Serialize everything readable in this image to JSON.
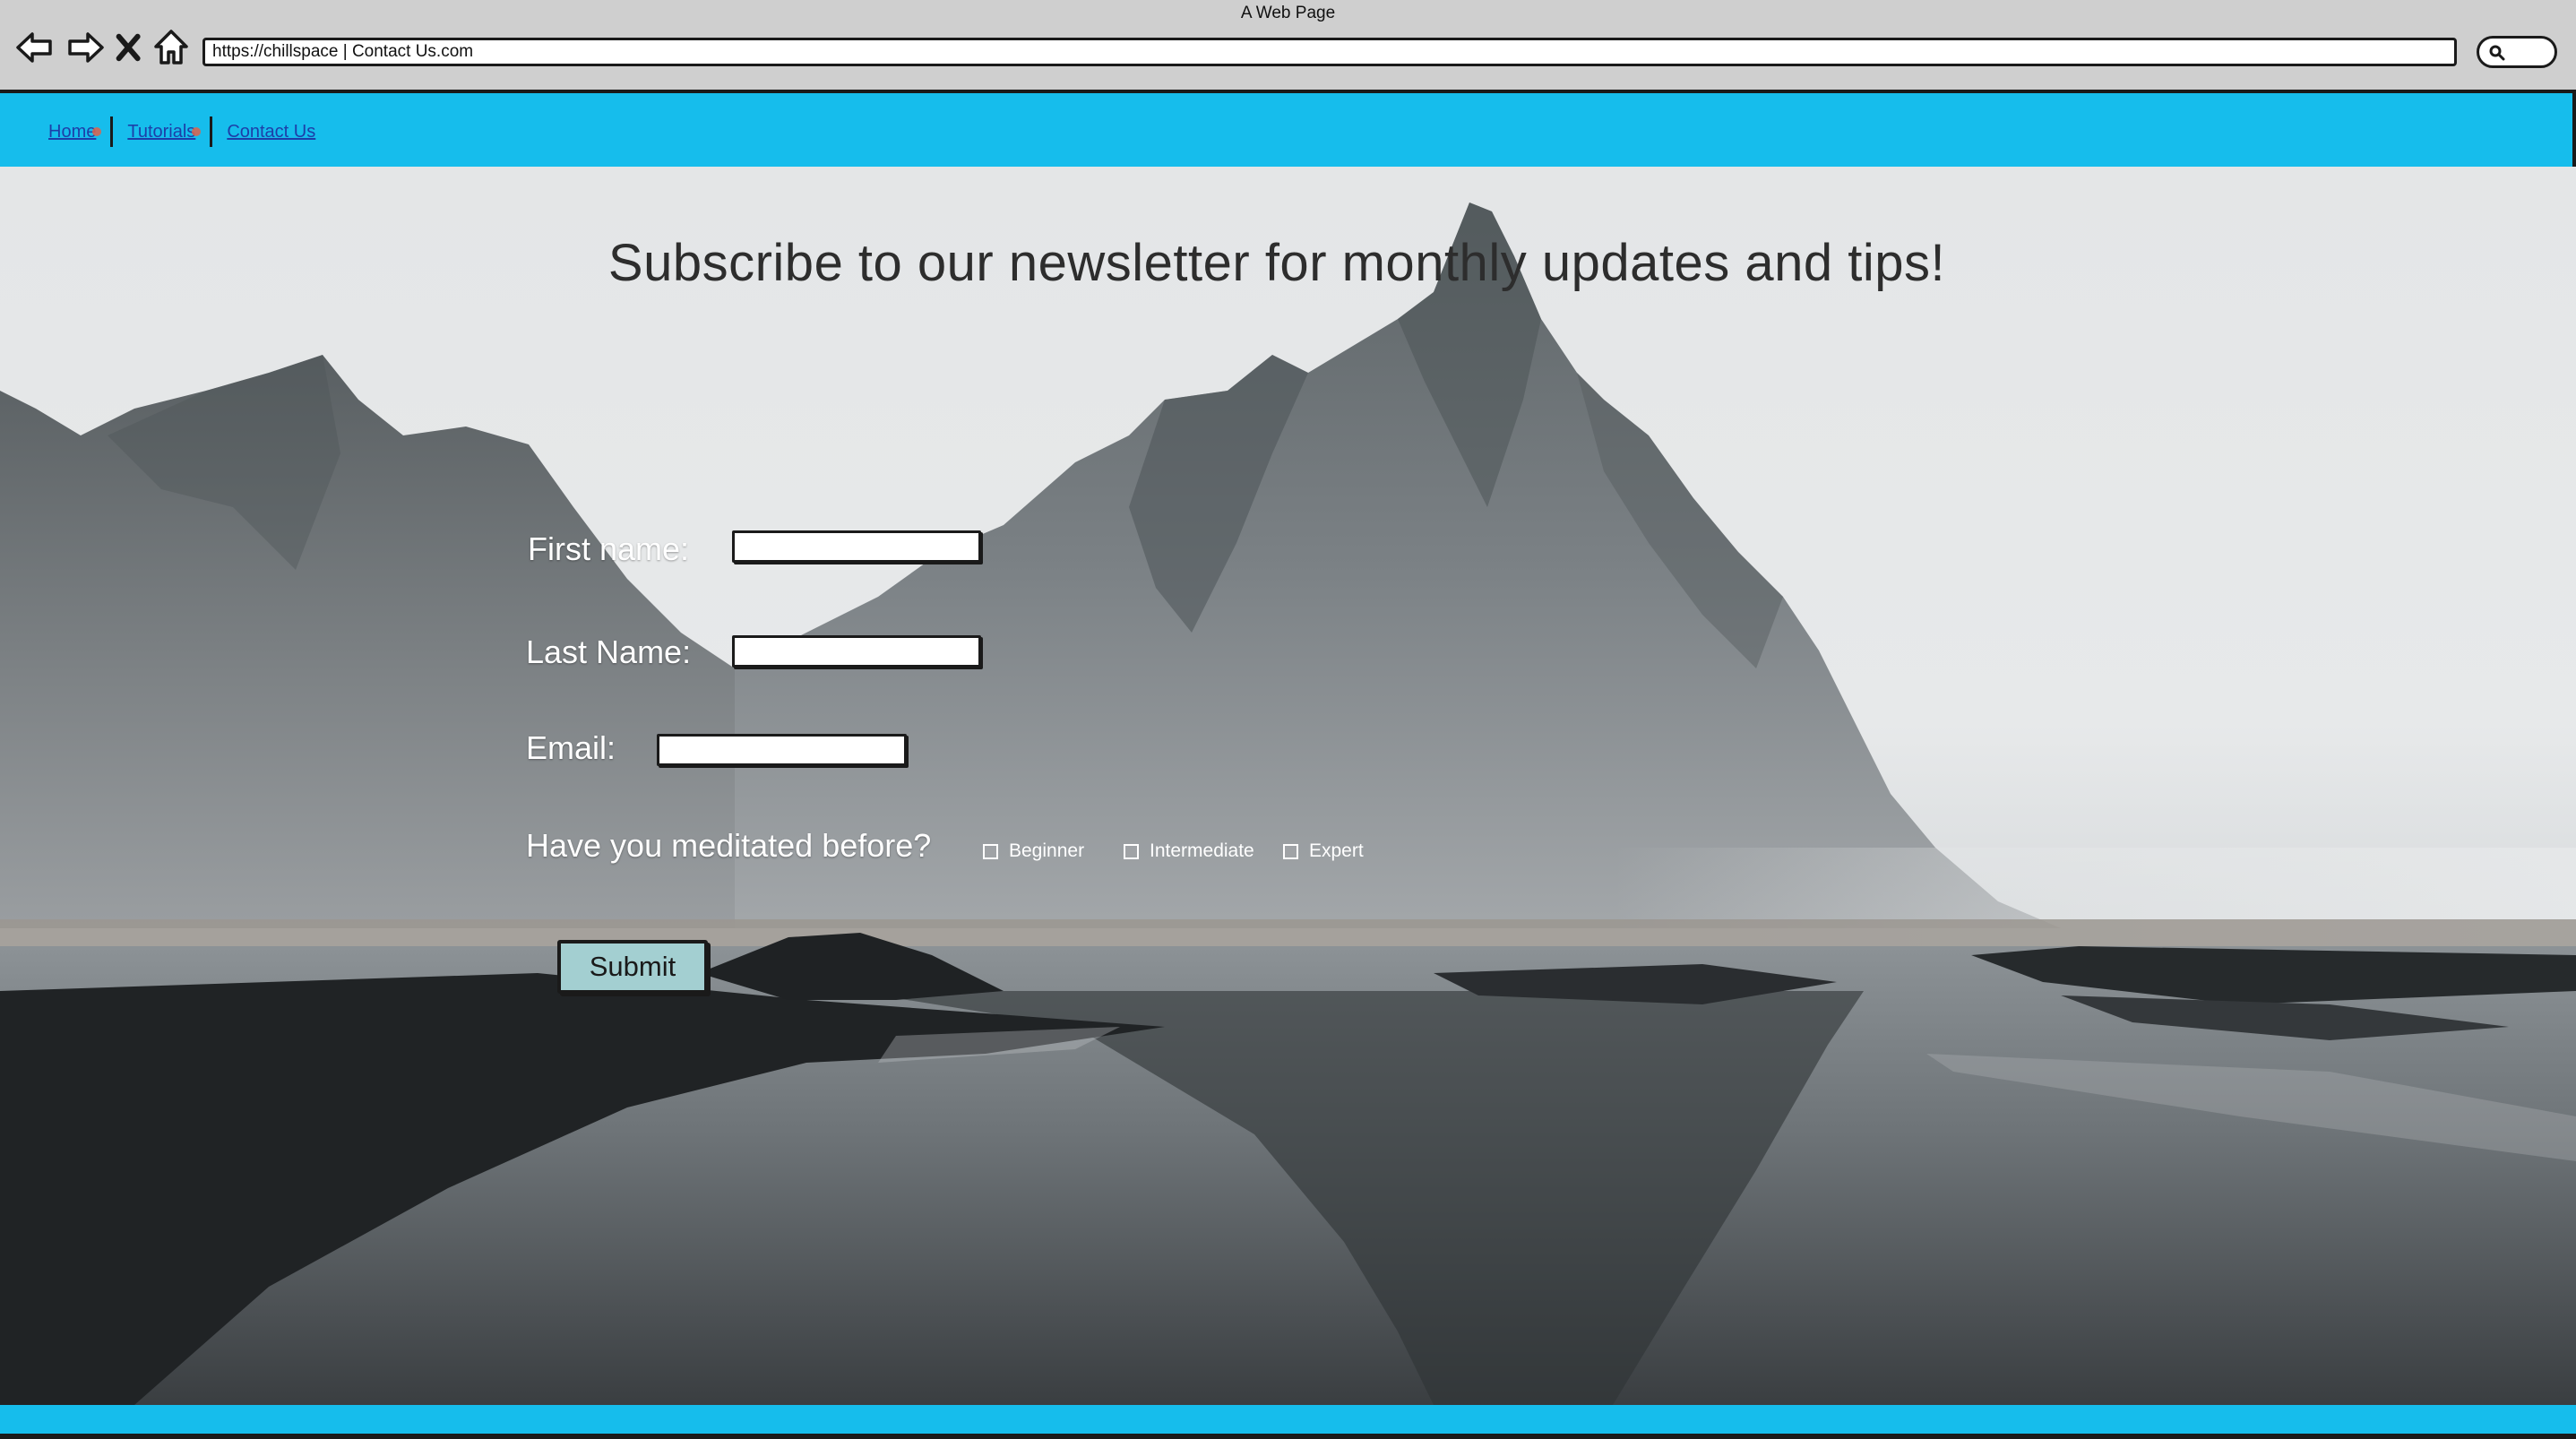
{
  "window": {
    "title": "A Web Page",
    "url": "https://chillspace | Contact Us.com"
  },
  "toolbar": {
    "icons": [
      "back-arrow-icon",
      "forward-arrow-icon",
      "close-x-icon",
      "home-icon",
      "search-icon"
    ]
  },
  "nav": {
    "items": [
      {
        "label": "Home"
      },
      {
        "label": "Tutorials"
      },
      {
        "label": "Contact Us"
      }
    ]
  },
  "page": {
    "headline": "Subscribe to our newsletter for monthly updates and tips!"
  },
  "form": {
    "first_name_label": "First name:",
    "first_name_value": "",
    "last_name_label": "Last Name:",
    "last_name_value": "",
    "email_label": "Email:",
    "email_value": "",
    "experience_question": "Have you meditated before?",
    "options": [
      {
        "label": "Beginner",
        "checked": false
      },
      {
        "label": "Intermediate",
        "checked": false
      },
      {
        "label": "Expert",
        "checked": false
      }
    ],
    "submit_label": "Submit"
  },
  "colors": {
    "nav_bar": "#16bdec",
    "submit_button": "#a3cfd1",
    "link": "#1d3fa8"
  }
}
